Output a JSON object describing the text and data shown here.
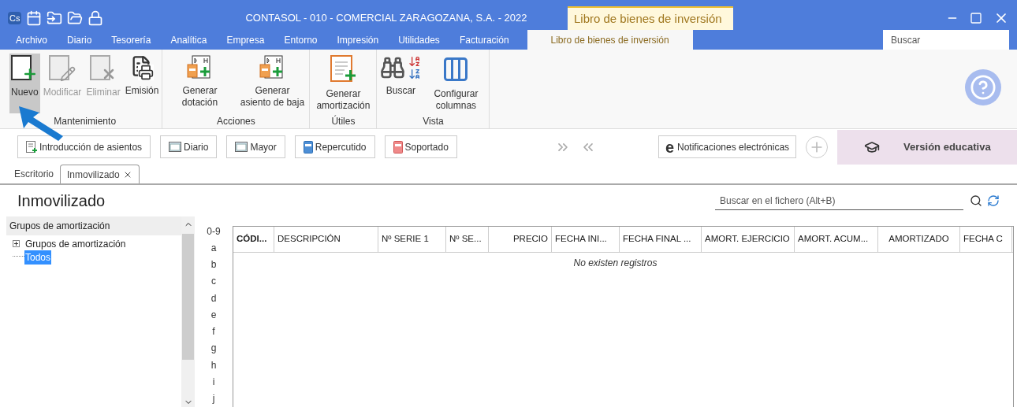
{
  "window": {
    "app_badge": "Cs",
    "title": "CONTASOL - 010 - COMERCIAL ZARAGOZANA, S.A. - 2022",
    "context_title": "Libro de bienes de inversión"
  },
  "menu": [
    {
      "label": "Archivo",
      "selected": false
    },
    {
      "label": "Diario",
      "selected": false
    },
    {
      "label": "Tesorería",
      "selected": false
    },
    {
      "label": "Analítica",
      "selected": false
    },
    {
      "label": "Empresa",
      "selected": false
    },
    {
      "label": "Entorno",
      "selected": false
    },
    {
      "label": "Impresión",
      "selected": false
    },
    {
      "label": "Utilidades",
      "selected": false
    },
    {
      "label": "Facturación",
      "selected": false
    },
    {
      "label": "Libro de bienes de inversión",
      "selected": true
    }
  ],
  "search": {
    "placeholder": "Buscar"
  },
  "ribbon": [
    {
      "label": "Mantenimiento",
      "buttons": [
        {
          "kind": "new",
          "label": "Nuevo",
          "disabled": false,
          "pressed": true
        },
        {
          "kind": "edit",
          "label": "Modificar",
          "disabled": true,
          "pressed": false
        },
        {
          "kind": "delete",
          "label": "Eliminar",
          "disabled": true,
          "pressed": false
        },
        {
          "kind": "print",
          "label": "Emisión",
          "disabled": false,
          "pressed": false
        }
      ]
    },
    {
      "label": "Acciones",
      "buttons": [
        {
          "kind": "dh",
          "label": "Generar dotación",
          "disabled": false,
          "pressed": false
        },
        {
          "kind": "dh",
          "label": "Generar asiento de baja",
          "disabled": false,
          "pressed": false
        }
      ]
    },
    {
      "label": "Útiles",
      "buttons": [
        {
          "kind": "sheet",
          "label": "Generar amortización",
          "disabled": false,
          "pressed": false
        }
      ]
    },
    {
      "label": "Vista",
      "buttons": [
        {
          "kind": "find",
          "label": "Buscar",
          "disabled": false,
          "pressed": false
        },
        {
          "kind": "columns",
          "label": "Configurar columnas",
          "disabled": false,
          "pressed": false
        }
      ]
    }
  ],
  "quick_buttons": [
    {
      "kind": "entries",
      "label": "Introducción de asientos"
    },
    {
      "kind": "screen",
      "label": "Diario"
    },
    {
      "kind": "screen",
      "label": "Mayor"
    },
    {
      "kind": "blue",
      "label": "Repercutido"
    },
    {
      "kind": "red",
      "label": "Soportado"
    }
  ],
  "notifications_button": {
    "icon_letter": "e",
    "label": "Notificaciones electrónicas"
  },
  "edition_banner": "Versión educativa",
  "doc_tabs": [
    {
      "label": "Escritorio",
      "selected": false
    },
    {
      "label": "Inmovilizado",
      "selected": true
    }
  ],
  "page_title": "Inmovilizado",
  "file_search": {
    "placeholder": "Buscar en el fichero (Alt+B)"
  },
  "tree": {
    "header": "Grupos de amortización",
    "items": [
      {
        "label": "Grupos de amortización",
        "expanded": false,
        "selected": false
      },
      {
        "label": "Todos",
        "selected": true
      }
    ]
  },
  "letters": [
    "0-9",
    "a",
    "b",
    "c",
    "d",
    "e",
    "f",
    "g",
    "h",
    "i",
    "j"
  ],
  "table": {
    "columns": [
      "CÓDI...",
      "DESCRIPCIÓN",
      "Nº SERIE 1",
      "Nº SE...",
      "PRECIO",
      "FECHA INI...",
      "FECHA FINAL ...",
      "AMORT. EJERCICIO",
      "AMORT. ACUM...",
      "AMORTIZADO",
      "FECHA C"
    ],
    "empty_message": "No existen registros"
  }
}
